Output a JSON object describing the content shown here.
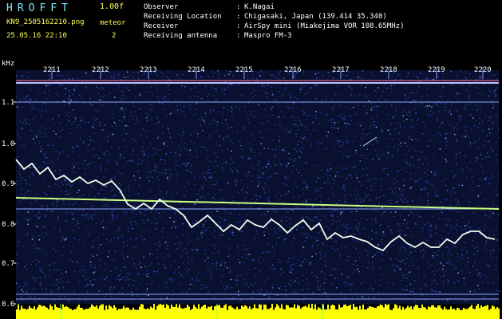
{
  "header": {
    "app_title": "HROFFT",
    "app_version": "1.00f",
    "file_name": "KN9_2505162210.png",
    "meteor_label": "meteor",
    "timestamp": "25.05.16 22:10",
    "meteor_count": "2"
  },
  "meta": [
    {
      "key": "Observer",
      "value": "K.Nagai"
    },
    {
      "key": "Receiving Location",
      "value": "Chigasaki, Japan (139.414 35.340)"
    },
    {
      "key": "Receiver",
      "value": "AirSpy mini (Miakejima VOR 108.65MHz)"
    },
    {
      "key": "Receiving antenna",
      "value": "Maspro FM-3"
    }
  ],
  "spectrogram": {
    "y_unit": "kHz",
    "y_ticks": [
      "1.1",
      "1.0",
      "0.9",
      "0.8",
      "0.7",
      "0.6"
    ],
    "time_ticks": [
      "2211",
      "2212",
      "2213",
      "2214",
      "2215",
      "2216",
      "2217",
      "2218",
      "2219",
      "2220"
    ],
    "colors": {
      "background": "#0a1030",
      "noise": "#2a3f9f",
      "signal": "#ffffff",
      "audio_bar": "#ffff00",
      "grid": "#7f9fff"
    }
  }
}
